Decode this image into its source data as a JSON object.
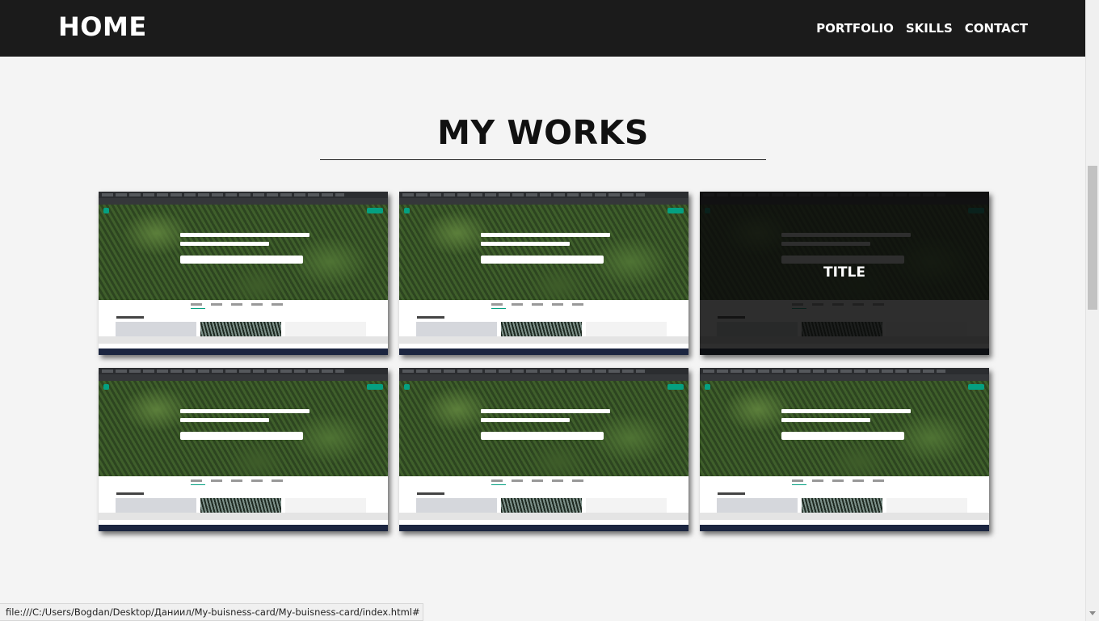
{
  "nav": {
    "brand": "HOME",
    "links": [
      "PORTFOLIO",
      "SKILLS",
      "CONTACT"
    ]
  },
  "works": {
    "heading": "MY WORKS",
    "hover_title": "TITLE",
    "items": [
      {
        "screenshot": "pexels-homepage",
        "hovered": false
      },
      {
        "screenshot": "pexels-homepage",
        "hovered": false
      },
      {
        "screenshot": "pexels-homepage",
        "hovered": true
      },
      {
        "screenshot": "pexels-homepage",
        "hovered": false
      },
      {
        "screenshot": "pexels-homepage",
        "hovered": false
      },
      {
        "screenshot": "pexels-homepage",
        "hovered": false
      }
    ]
  },
  "status_bar": {
    "url": "file:///C:/Users/Bogdan/Desktop/Даниил/My-buisness-card/My-buisness-card/index.html#"
  },
  "colors": {
    "nav_bg": "#1b1b1b",
    "page_bg": "#f4f4f4",
    "accent": "#05a081"
  }
}
